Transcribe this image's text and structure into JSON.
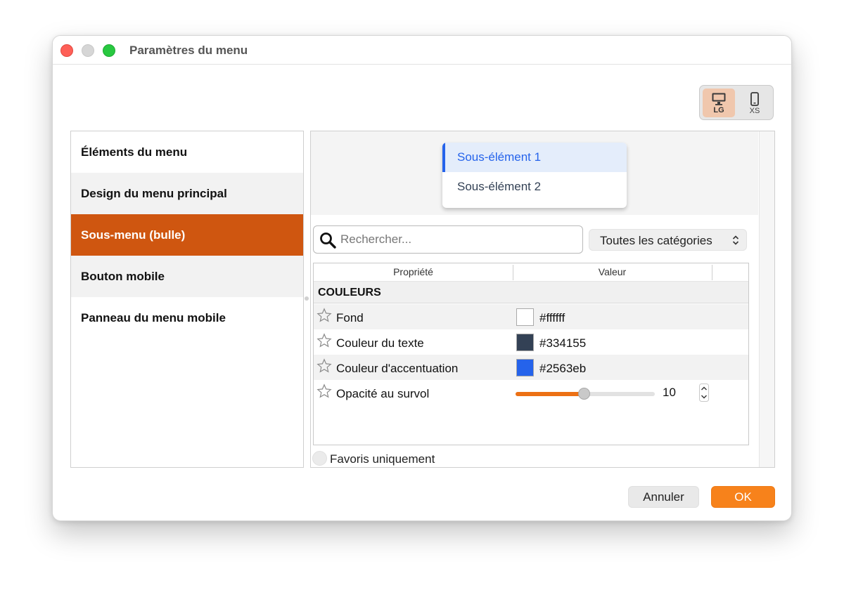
{
  "window": {
    "title": "Paramètres du menu"
  },
  "device_toggle": {
    "lg_label": "LG",
    "xs_label": "XS",
    "selected": "LG"
  },
  "sidebar": {
    "items": [
      {
        "label": "Éléments du menu"
      },
      {
        "label": "Design du menu principal"
      },
      {
        "label": "Sous-menu (bulle)",
        "active": true
      },
      {
        "label": "Bouton mobile"
      },
      {
        "label": "Panneau du menu mobile"
      }
    ]
  },
  "preview": {
    "items": [
      {
        "label": "Sous-élément 1",
        "active": true
      },
      {
        "label": "Sous-élément 2"
      }
    ]
  },
  "search": {
    "placeholder": "Rechercher...",
    "value": ""
  },
  "category_select": {
    "selected": "Toutes les catégories"
  },
  "grid": {
    "headers": {
      "property": "Propriété",
      "value": "Valeur"
    },
    "section": "COULEURS",
    "rows": [
      {
        "name": "Fond",
        "color": "#ffffff",
        "value": "#ffffff"
      },
      {
        "name": "Couleur du texte",
        "color": "#334155",
        "value": "#334155"
      },
      {
        "name": "Couleur d'accentuation",
        "color": "#2563eb",
        "value": "#2563eb"
      },
      {
        "name": "Opacité au survol",
        "value": "10",
        "slider_fraction": 0.49
      }
    ]
  },
  "favorites": {
    "label": "Favoris uniquement",
    "checked": false
  },
  "buttons": {
    "cancel": "Annuler",
    "ok": "OK"
  },
  "colors": {
    "accent": "#cf5610",
    "ok_button": "#f7821b",
    "slider_fill": "#ec7014"
  },
  "icons": {
    "device_lg": "desktop-monitor-icon",
    "device_xs": "mobile-phone-icon",
    "search": "search-icon",
    "star": "star-outline-icon",
    "chevron": "chevron-up-down-icon"
  }
}
